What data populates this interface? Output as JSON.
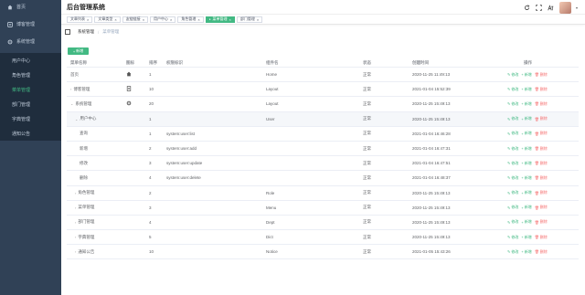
{
  "header": {
    "title": "后台管理系统"
  },
  "sidebar": {
    "items": [
      {
        "label": "首页",
        "icon": "home-icon"
      },
      {
        "label": "博客管理",
        "icon": "book-icon"
      },
      {
        "label": "系统管理",
        "icon": "gear-icon",
        "expanded": true
      }
    ],
    "sub_items": [
      {
        "label": "用户中心",
        "active": false
      },
      {
        "label": "角色管理",
        "active": false
      },
      {
        "label": "菜单管理",
        "active": true
      },
      {
        "label": "部门管理",
        "active": false
      },
      {
        "label": "字典管理",
        "active": false
      },
      {
        "label": "通知公告",
        "active": false
      }
    ]
  },
  "tags": [
    {
      "label": "文章列表",
      "active": false
    },
    {
      "label": "文章类型",
      "active": false
    },
    {
      "label": "友链链接",
      "active": false
    },
    {
      "label": "用户中心",
      "active": false
    },
    {
      "label": "角色管理",
      "active": false
    },
    {
      "label": "菜单管理",
      "active": true
    },
    {
      "label": "部门管理",
      "active": false
    }
  ],
  "breadcrumb": {
    "parent": "系统管理",
    "sep": "/",
    "current": "菜单管理"
  },
  "toolbar": {
    "add_label": "新增"
  },
  "colors": {
    "accent": "#42b983",
    "danger": "#f56c6c",
    "sidebar": "#304156",
    "sidebar_sub": "#1f2d3d"
  },
  "table": {
    "columns": [
      "菜单名称",
      "图标",
      "排序",
      "权限标识",
      "组件名",
      "状态",
      "创建时间",
      "操作"
    ],
    "ops": {
      "edit": "修改",
      "add": "新增",
      "delete": "删除"
    },
    "rows": [
      {
        "name": "首页",
        "caret": "",
        "level": 0,
        "icon": "home-icon",
        "sort": "1",
        "perm": "",
        "comp": "Home",
        "status": "正常",
        "time": "2020-11-25 11:49:13",
        "highlight": false
      },
      {
        "name": "博客管理",
        "caret": "›",
        "level": 0,
        "icon": "doc-icon",
        "sort": "10",
        "perm": "",
        "comp": "Layout",
        "status": "正常",
        "time": "2021-01-04 15:52:39",
        "highlight": false
      },
      {
        "name": "系统管理",
        "caret": "⌄",
        "level": 0,
        "icon": "gear-icon",
        "sort": "20",
        "perm": "",
        "comp": "Layout",
        "status": "正常",
        "time": "2020-11-25 15:49:13",
        "highlight": false
      },
      {
        "name": "用户中心",
        "caret": "⌄",
        "level": 1,
        "icon": "",
        "sort": "1",
        "perm": "",
        "comp": "User",
        "status": "正常",
        "time": "2020-11-25 15:49:13",
        "highlight": true
      },
      {
        "name": "查询",
        "caret": "",
        "level": 2,
        "icon": "",
        "sort": "1",
        "perm": "system:user:list",
        "comp": "",
        "status": "正常",
        "time": "2021-01-04 16:46:28",
        "highlight": false
      },
      {
        "name": "新增",
        "caret": "",
        "level": 2,
        "icon": "",
        "sort": "2",
        "perm": "system:user:add",
        "comp": "",
        "status": "正常",
        "time": "2021-01-04 16:47:31",
        "highlight": false
      },
      {
        "name": "修改",
        "caret": "",
        "level": 2,
        "icon": "",
        "sort": "3",
        "perm": "system:user:update",
        "comp": "",
        "status": "正常",
        "time": "2021-01-04 16:47:51",
        "highlight": false
      },
      {
        "name": "删除",
        "caret": "",
        "level": 2,
        "icon": "",
        "sort": "4",
        "perm": "system:user:delete",
        "comp": "",
        "status": "正常",
        "time": "2021-01-04 16:48:37",
        "highlight": false
      },
      {
        "name": "角色管理",
        "caret": "›",
        "level": 1,
        "icon": "",
        "sort": "2",
        "perm": "",
        "comp": "Role",
        "status": "正常",
        "time": "2020-11-25 15:49:13",
        "highlight": false
      },
      {
        "name": "菜单管理",
        "caret": "›",
        "level": 1,
        "icon": "",
        "sort": "3",
        "perm": "",
        "comp": "Menu",
        "status": "正常",
        "time": "2020-11-25 15:49:13",
        "highlight": false
      },
      {
        "name": "部门管理",
        "caret": "›",
        "level": 1,
        "icon": "",
        "sort": "4",
        "perm": "",
        "comp": "Dept",
        "status": "正常",
        "time": "2020-11-25 15:49:13",
        "highlight": false
      },
      {
        "name": "字典管理",
        "caret": "›",
        "level": 1,
        "icon": "",
        "sort": "5",
        "perm": "",
        "comp": "Dict",
        "status": "正常",
        "time": "2020-11-25 15:49:13",
        "highlight": false
      },
      {
        "name": "通知公告",
        "caret": "›",
        "level": 1,
        "icon": "",
        "sort": "10",
        "perm": "",
        "comp": "Notice",
        "status": "正常",
        "time": "2021-01-05 15:43:26",
        "highlight": false
      }
    ]
  }
}
